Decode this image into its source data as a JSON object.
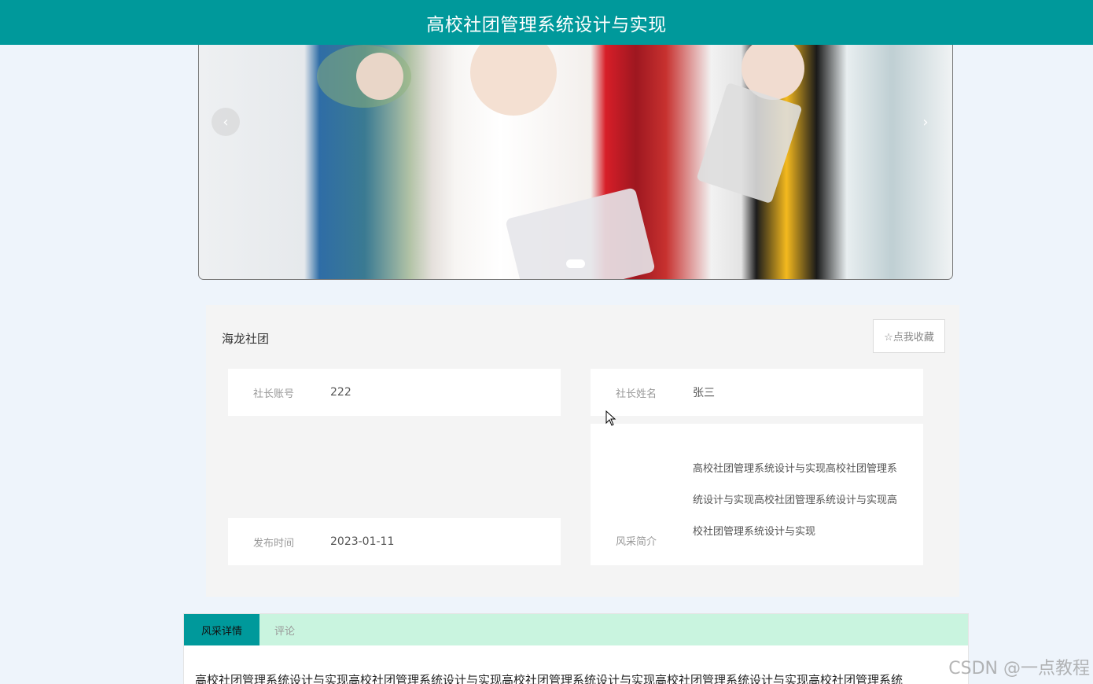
{
  "header": {
    "title": "高校社团管理系统设计与实现"
  },
  "carousel": {
    "prev": "‹",
    "next": "›"
  },
  "club": {
    "name": "海龙社团",
    "favorite_label": "☆点我收藏",
    "fields": {
      "account": {
        "label": "社长账号",
        "value": "222"
      },
      "leader": {
        "label": "社长姓名",
        "value": "张三"
      },
      "publish_time": {
        "label": "发布时间",
        "value": "2023-01-11"
      },
      "intro": {
        "label": "风采简介",
        "value": "高校社团管理系统设计与实现高校社团管理系统设计与实现高校社团管理系统设计与实现高校社团管理系统设计与实现"
      }
    }
  },
  "tabs": [
    {
      "label": "风采详情"
    },
    {
      "label": "评论"
    }
  ],
  "detail": {
    "text": "高校社团管理系统设计与实现高校社团管理系统设计与实现高校社团管理系统设计与实现高校社团管理系统设计与实现高校社团管理系统"
  },
  "watermark": "CSDN @一点教程",
  "colors": {
    "primary": "#00999b",
    "tabbar": "#c9f4df",
    "background": "#eef4fb"
  }
}
